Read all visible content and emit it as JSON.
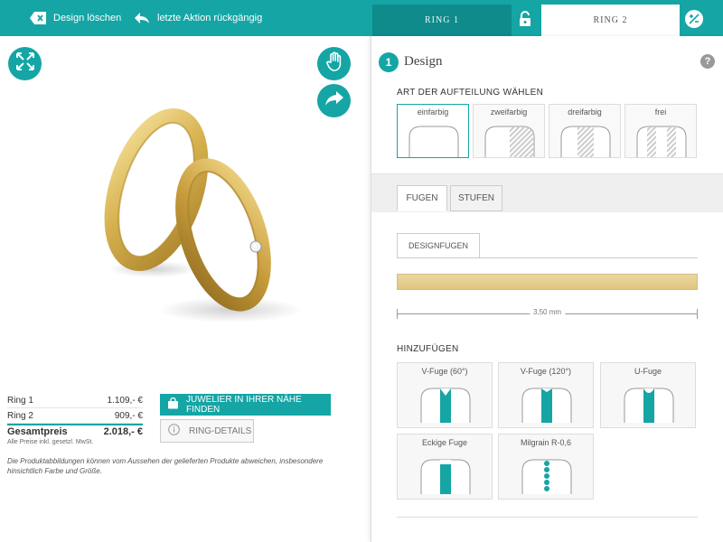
{
  "topbar": {
    "delete_label": "Design löschen",
    "undo_label": "letzte Aktion rückgängig",
    "ring1_tab": "RING 1",
    "ring2_tab": "RING 2"
  },
  "viewer": {
    "icons": [
      "expand-icon",
      "hand-icon",
      "share-icon"
    ]
  },
  "prices": {
    "rows": [
      {
        "label": "Ring 1",
        "value": "1.109,- €"
      },
      {
        "label": "Ring 2",
        "value": "909,- €"
      }
    ],
    "total_label": "Gesamtpreis",
    "total_value": "2.018,- €",
    "note": "Alle Preise inkl. gesetzl. MwSt."
  },
  "buttons": {
    "find_jeweler": "JUWELIER IN IHRER NÄHE FINDEN",
    "ring_details": "RING-DETAILS"
  },
  "disclaimer": "Die Produktabbildungen können vom Aussehen der gelieferten Produkte abweichen, insbesondere hinsichtlich Farbe und Größe.",
  "panel": {
    "step": "1",
    "title": "Design",
    "help": "?",
    "split_label": "ART DER AUFTEILUNG WÄHLEN",
    "split_options": [
      "einfarbig",
      "zweifarbig",
      "dreifarbig",
      "frei"
    ],
    "selected_split": "einfarbig",
    "tabs": [
      "FUGEN",
      "STUFEN"
    ],
    "active_tab": "FUGEN",
    "subtab": "DESIGNFUGEN",
    "width_value": "3,50 mm",
    "add_label": "HINZUFÜGEN",
    "fugen": [
      "V-Fuge (60°)",
      "V-Fuge (120°)",
      "U-Fuge",
      "Eckige Fuge",
      "Milgrain R-0,6"
    ]
  },
  "colors": {
    "accent": "#15a5a5",
    "accent_dark": "#0f8b8b",
    "gold": "#e3cb88"
  }
}
